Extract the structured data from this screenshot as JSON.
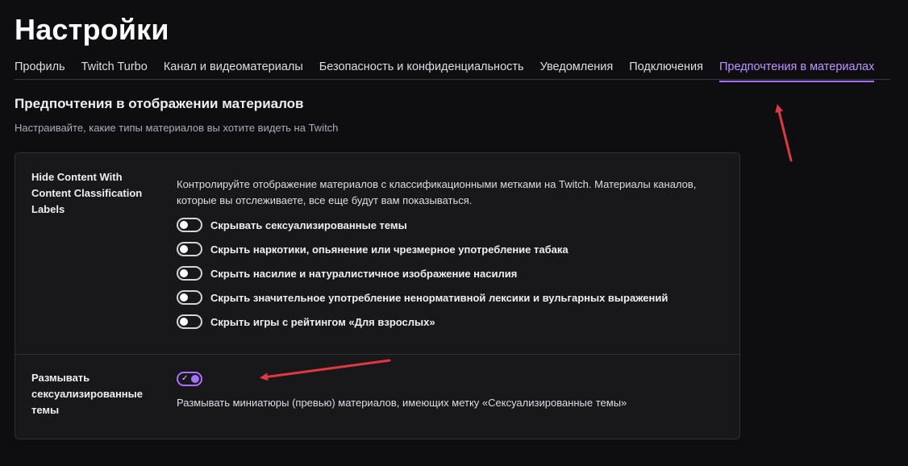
{
  "page": {
    "title": "Настройки"
  },
  "tabs": [
    {
      "label": "Профиль",
      "active": false
    },
    {
      "label": "Twitch Turbo",
      "active": false
    },
    {
      "label": "Канал и видеоматериалы",
      "active": false
    },
    {
      "label": "Безопасность и конфиденциальность",
      "active": false
    },
    {
      "label": "Уведомления",
      "active": false
    },
    {
      "label": "Подключения",
      "active": false
    },
    {
      "label": "Предпочтения в материалах",
      "active": true
    }
  ],
  "section": {
    "title": "Предпочтения в отображении материалов",
    "subtitle": "Настраивайте, какие типы материалов вы хотите видеть на Twitch"
  },
  "hide_content": {
    "label": "Hide Content With Content Classification Labels",
    "description": "Контролируйте отображение материалов с классификационными метками на Twitch. Материалы каналов, которые вы отслеживаете, все еще будут вам показываться.",
    "options": [
      {
        "label": "Скрывать сексуализированные темы",
        "enabled": false
      },
      {
        "label": "Скрыть наркотики, опьянение или чрезмерное употребление табака",
        "enabled": false
      },
      {
        "label": "Скрыть насилие и натуралистичное изображение насилия",
        "enabled": false
      },
      {
        "label": "Скрыть значительное употребление ненормативной лексики и вульгарных выражений",
        "enabled": false
      },
      {
        "label": "Скрыть игры с рейтингом «Для взрослых»",
        "enabled": false
      }
    ]
  },
  "blur": {
    "label": "Размывать сексуализированные темы",
    "enabled": true,
    "description": "Размывать миниатюры (превью) материалов, имеющих метку «Сексуализированные темы»"
  },
  "colors": {
    "background": "#0e0e10",
    "card": "#18181b",
    "accent": "#a970ff",
    "annotation_arrow": "#e0393e"
  }
}
